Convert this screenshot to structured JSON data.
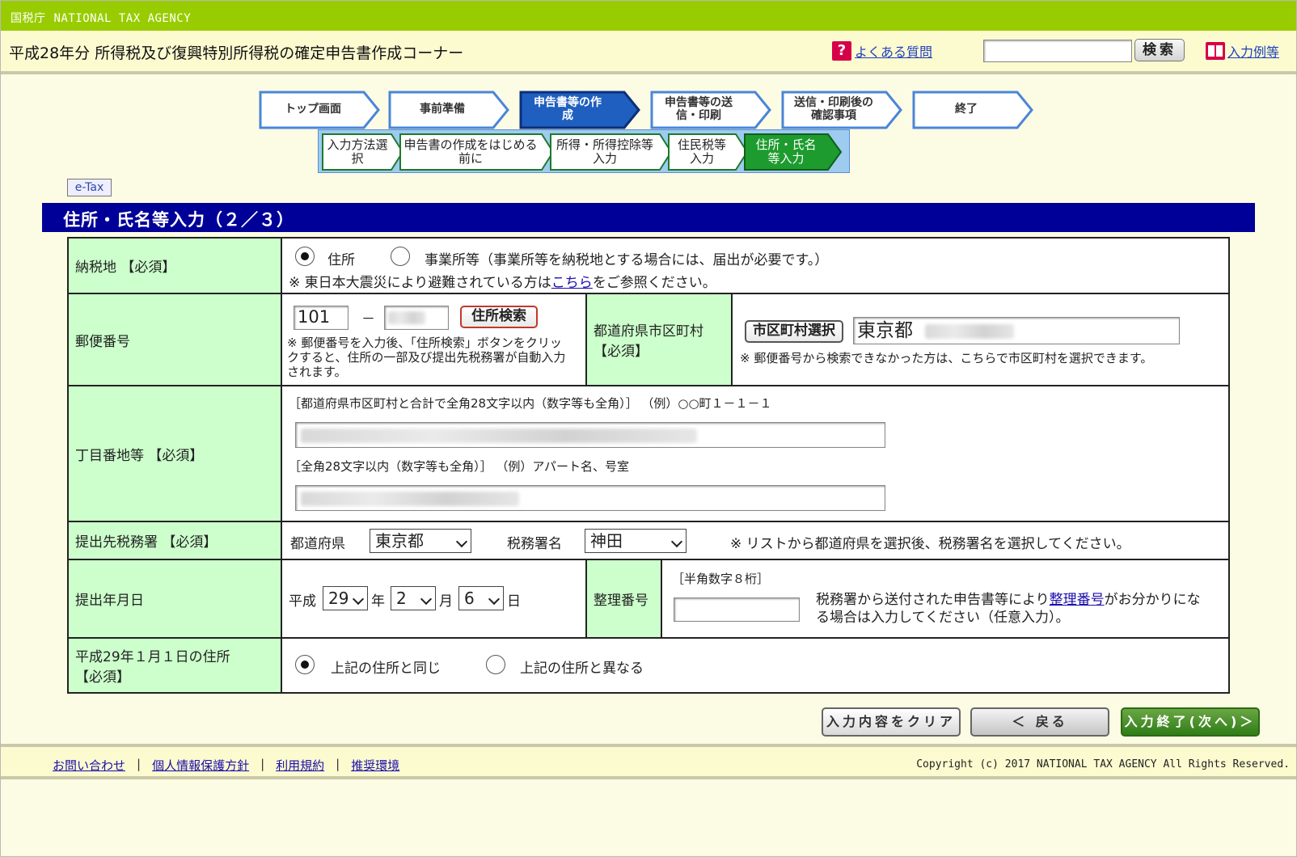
{
  "agency": {
    "ja": "国税庁",
    "en": "NATIONAL TAX AGENCY"
  },
  "header": {
    "title": "平成28年分 所得税及び復興特別所得税の確定申告書作成コーナー",
    "faq_label": "よくある質問",
    "faq_icon": "?",
    "search_placeholder": "",
    "search_button": "検索",
    "example_label": "入力例等"
  },
  "steps": [
    {
      "label": "トップ画面",
      "active": false
    },
    {
      "label": "事前準備",
      "active": false
    },
    {
      "label": "申告書等の作成",
      "active": true
    },
    {
      "label": "申告書等の送信・印刷",
      "active": false
    },
    {
      "label": "送信・印刷後の確認事項",
      "active": false
    },
    {
      "label": "終了",
      "active": false
    }
  ],
  "substeps": [
    {
      "label": "入力方法選択",
      "active": false
    },
    {
      "label": "申告書の作成をはじめる前に",
      "active": false
    },
    {
      "label": "所得・所得控除等入力",
      "active": false
    },
    {
      "label": "住民税等入力",
      "active": false
    },
    {
      "label": "住所・氏名等入力",
      "active": true
    }
  ],
  "etax": "e-Tax",
  "section_title": "住所・氏名等入力（２／３）",
  "form": {
    "nozeichi": {
      "label": "納税地 【必須】",
      "option1": "住所",
      "option2": "事業所等（事業所等を納税地とする場合には、届出が必要です。）",
      "note_prefix": "※ 東日本大震災により避難されている方は",
      "note_link": "こちら",
      "note_suffix": "をご参照ください。"
    },
    "postal": {
      "label": "郵便番号",
      "value1": "101",
      "dash": "－",
      "search_button": "住所検索",
      "note": "※ 郵便番号を入力後、「住所検索」ボタンをクリックすると、住所の一部及び提出先税務署が自動入力されます。"
    },
    "prefecture_city": {
      "label_line1": "都道府県市区町村",
      "label_line2": "【必須】",
      "select_button": "市区町村選択",
      "value": "東京都",
      "note": "※ 郵便番号から検索できなかった方は、こちらで市区町村を選択できます。"
    },
    "chome": {
      "label": "丁目番地等 【必須】",
      "hint1": "［都道府県市区町村と合計で全角28文字以内（数字等も全角）］ （例）○○町１－１－１",
      "hint2": "［全角28文字以内（数字等も全角）］ （例）アパート名、号室"
    },
    "tax_office": {
      "label": "提出先税務署 【必須】",
      "pref_label": "都道府県",
      "pref_value": "東京都",
      "office_label": "税務署名",
      "office_value": "神田",
      "note": "※ リストから都道府県を選択後、税務署名を選択してください。"
    },
    "date": {
      "label": "提出年月日",
      "era": "平成",
      "year": "29",
      "year_unit": "年",
      "month": "2",
      "month_unit": "月",
      "day": "6",
      "day_unit": "日"
    },
    "seiri": {
      "label": "整理番号",
      "hint": "［半角数字８桁］",
      "note_prefix": "税務署から送付された申告書等により",
      "note_link": "整理番号",
      "note_suffix": "がお分かりになる場合は入力してください（任意入力）。"
    },
    "jan1": {
      "label_line1": "平成29年１月１日の住所",
      "label_line2": "【必須】",
      "option1": "上記の住所と同じ",
      "option2": "上記の住所と異なる"
    }
  },
  "buttons": {
    "clear": "入力内容をクリア",
    "back": "＜ 戻る",
    "next": "入力終了(次へ)＞"
  },
  "footer": {
    "links": [
      "お問い合わせ",
      "個人情報保護方針",
      "利用規約",
      "推奨環境"
    ],
    "copyright": "Copyright (c) 2017 NATIONAL TAX AGENCY All Rights Reserved."
  },
  "colors": {
    "agency_bar": "#99cc00",
    "section_head": "#000099",
    "label_cell": "#ccffcc",
    "active_step": "#1f5fc0",
    "active_substep": "#1e9b2e"
  }
}
